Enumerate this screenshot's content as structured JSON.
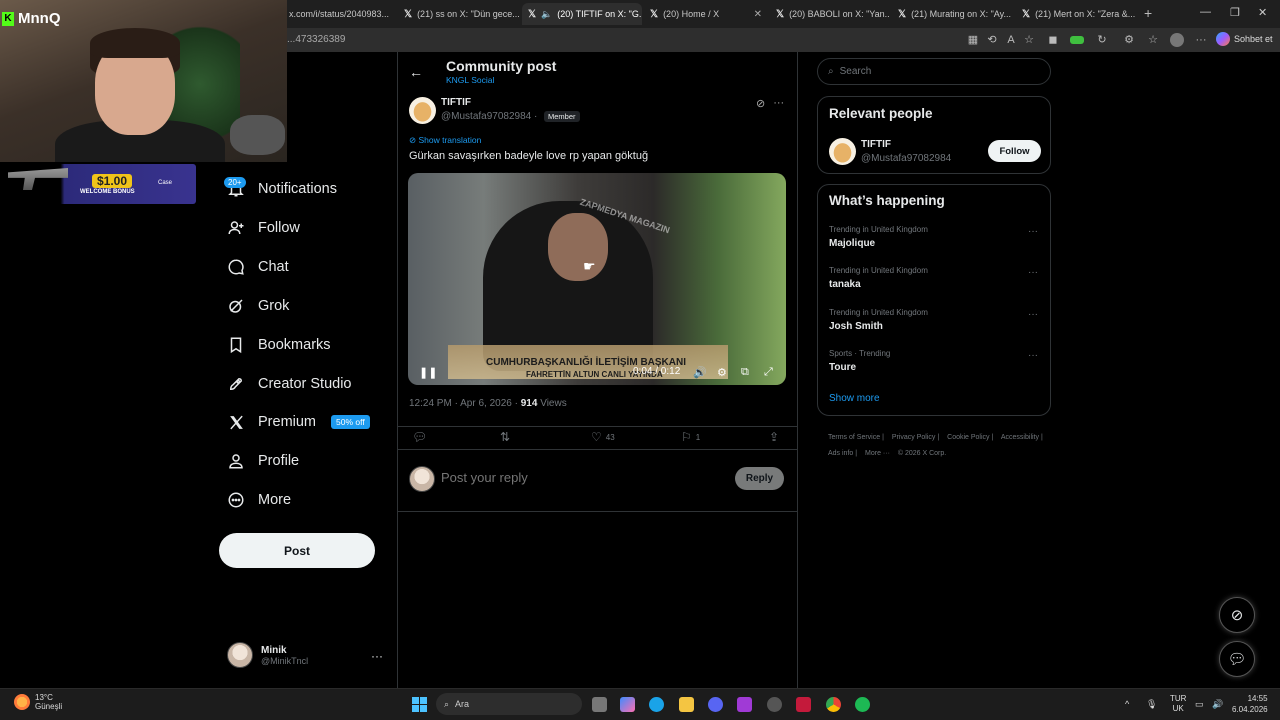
{
  "browser": {
    "tabs": [
      {
        "label": "x.com/i/status/2040983..."
      },
      {
        "label": "(21) ss on X: \"Dün gece..."
      },
      {
        "label": "(20) TIFTIF on X: \"G..."
      },
      {
        "label": "(20) Home / X"
      },
      {
        "label": "(20) BABOLI on X: \"Yan..."
      },
      {
        "label": "(21) Murating on X: \"Ay..."
      },
      {
        "label": "(21) Mert on X: \"Zera &..."
      }
    ],
    "url": "...473326389",
    "copilot_label": "Sohbet et"
  },
  "stream": {
    "channel_name": "MnnQ",
    "promo_amount": "$1.00",
    "promo_text": "WELCOME BONUS",
    "promo_brand": "Case"
  },
  "sidebar": {
    "partial_items": [
      "e",
      "ore"
    ],
    "notif_badge": "20+",
    "items": [
      {
        "label": "Notifications",
        "icon": "bell-icon"
      },
      {
        "label": "Follow",
        "icon": "person-add-icon"
      },
      {
        "label": "Chat",
        "icon": "chat-icon"
      },
      {
        "label": "Grok",
        "icon": "grok-icon"
      },
      {
        "label": "Bookmarks",
        "icon": "bookmark-icon"
      },
      {
        "label": "Creator Studio",
        "icon": "rocket-icon"
      },
      {
        "label": "Premium",
        "icon": "x-logo-icon",
        "badge": "50% off"
      },
      {
        "label": "Profile",
        "icon": "person-icon"
      },
      {
        "label": "More",
        "icon": "more-circle-icon"
      }
    ],
    "post_button": "Post",
    "account": {
      "name": "Minik",
      "handle": "@MinikTncl"
    }
  },
  "main": {
    "header_title": "Community post",
    "header_sub": "KNGL Social",
    "post": {
      "author_name": "TIFTIF",
      "author_handle": "@Mustafa97082984 ·",
      "member_badge": "Member",
      "show_translation": "Show translation",
      "text": "Gürkan savaşırken badeyle love rp yapan göktuğ",
      "video": {
        "watermark": "ZAPMEDYA MAGAZIN",
        "lower_third": "CUMHURBAŞKANLIĞI İLETİŞİM BAŞKANI",
        "lower_third_2": "FAHRETTİN ALTUN CANLI YAYINDA",
        "time": "0:04 / 0:12"
      },
      "timestamp": "12:24 PM · Apr 6, 2026 ·",
      "views_count": "914",
      "views_label": "Views",
      "likes": "43",
      "bookmarks": "1"
    },
    "reply_placeholder": "Post your reply",
    "reply_button": "Reply"
  },
  "right": {
    "search_placeholder": "Search",
    "relevant_title": "Relevant people",
    "relevant_person": {
      "name": "TIFTIF",
      "handle": "@Mustafa97082984",
      "button": "Follow"
    },
    "happening_title": "What’s happening",
    "trends": [
      {
        "context": "Trending in United Kingdom",
        "name": "Majolique"
      },
      {
        "context": "Trending in United Kingdom",
        "name": "tanaka"
      },
      {
        "context": "Trending in United Kingdom",
        "name": "Josh Smith"
      },
      {
        "context": "Sports · Trending",
        "name": "Toure"
      }
    ],
    "show_more": "Show more",
    "footer": [
      "Terms of Service |",
      "Privacy Policy |",
      "Cookie Policy |",
      "Accessibility |",
      "Ads info |",
      "More ···",
      "© 2026 X Corp."
    ]
  },
  "taskbar": {
    "temp": "13°C",
    "weather": "Güneşli",
    "search": "Ara",
    "lang_1": "TUR",
    "lang_2": "UK",
    "time": "14:55",
    "date": "6.04.2026"
  }
}
